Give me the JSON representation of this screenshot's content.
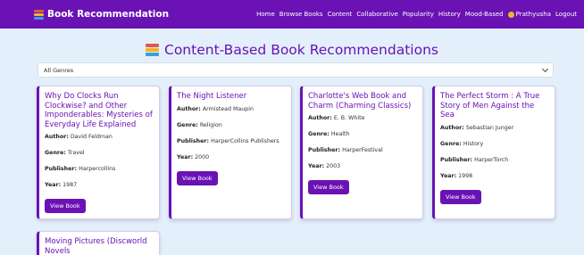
{
  "navbar": {
    "brand": "Book Recommendation",
    "links": [
      "Home",
      "Browse Books",
      "Content",
      "Collaborative",
      "Popularity",
      "History",
      "Mood-Based"
    ],
    "user": "Prathyusha",
    "logout": "Logout"
  },
  "page": {
    "heading": "Content-Based Book Recommendations"
  },
  "filter": {
    "selected": "All Genres"
  },
  "labels": {
    "author": "Author:",
    "genre": "Genre:",
    "publisher": "Publisher:",
    "year": "Year:",
    "view": "View Book"
  },
  "books": [
    {
      "title": "Why Do Clocks Run Clockwise? and Other Imponderables: Mysteries of Everyday Life Explained",
      "author": "David Feldman",
      "genre": "Travel",
      "publisher": "Harpercollins",
      "year": "1987"
    },
    {
      "title": "The Night Listener",
      "author": "Armistead Maupin",
      "genre": "Religion",
      "publisher": "HarperCollins Publishers",
      "year": "2000"
    },
    {
      "title": "Charlotte's Web Book and Charm (Charming Classics)",
      "author": "E. B. White",
      "genre": "Health",
      "publisher": "HarperFestival",
      "year": "2003"
    },
    {
      "title": "The Perfect Storm : A True Story of Men Against the Sea",
      "author": "Sebastian Junger",
      "genre": "History",
      "publisher": "HarperTorch",
      "year": "1998"
    },
    {
      "title": "Moving Pictures (Discworld Novels"
    }
  ],
  "colors": {
    "accent": "#6a12b4",
    "background": "#e3f0fb"
  }
}
